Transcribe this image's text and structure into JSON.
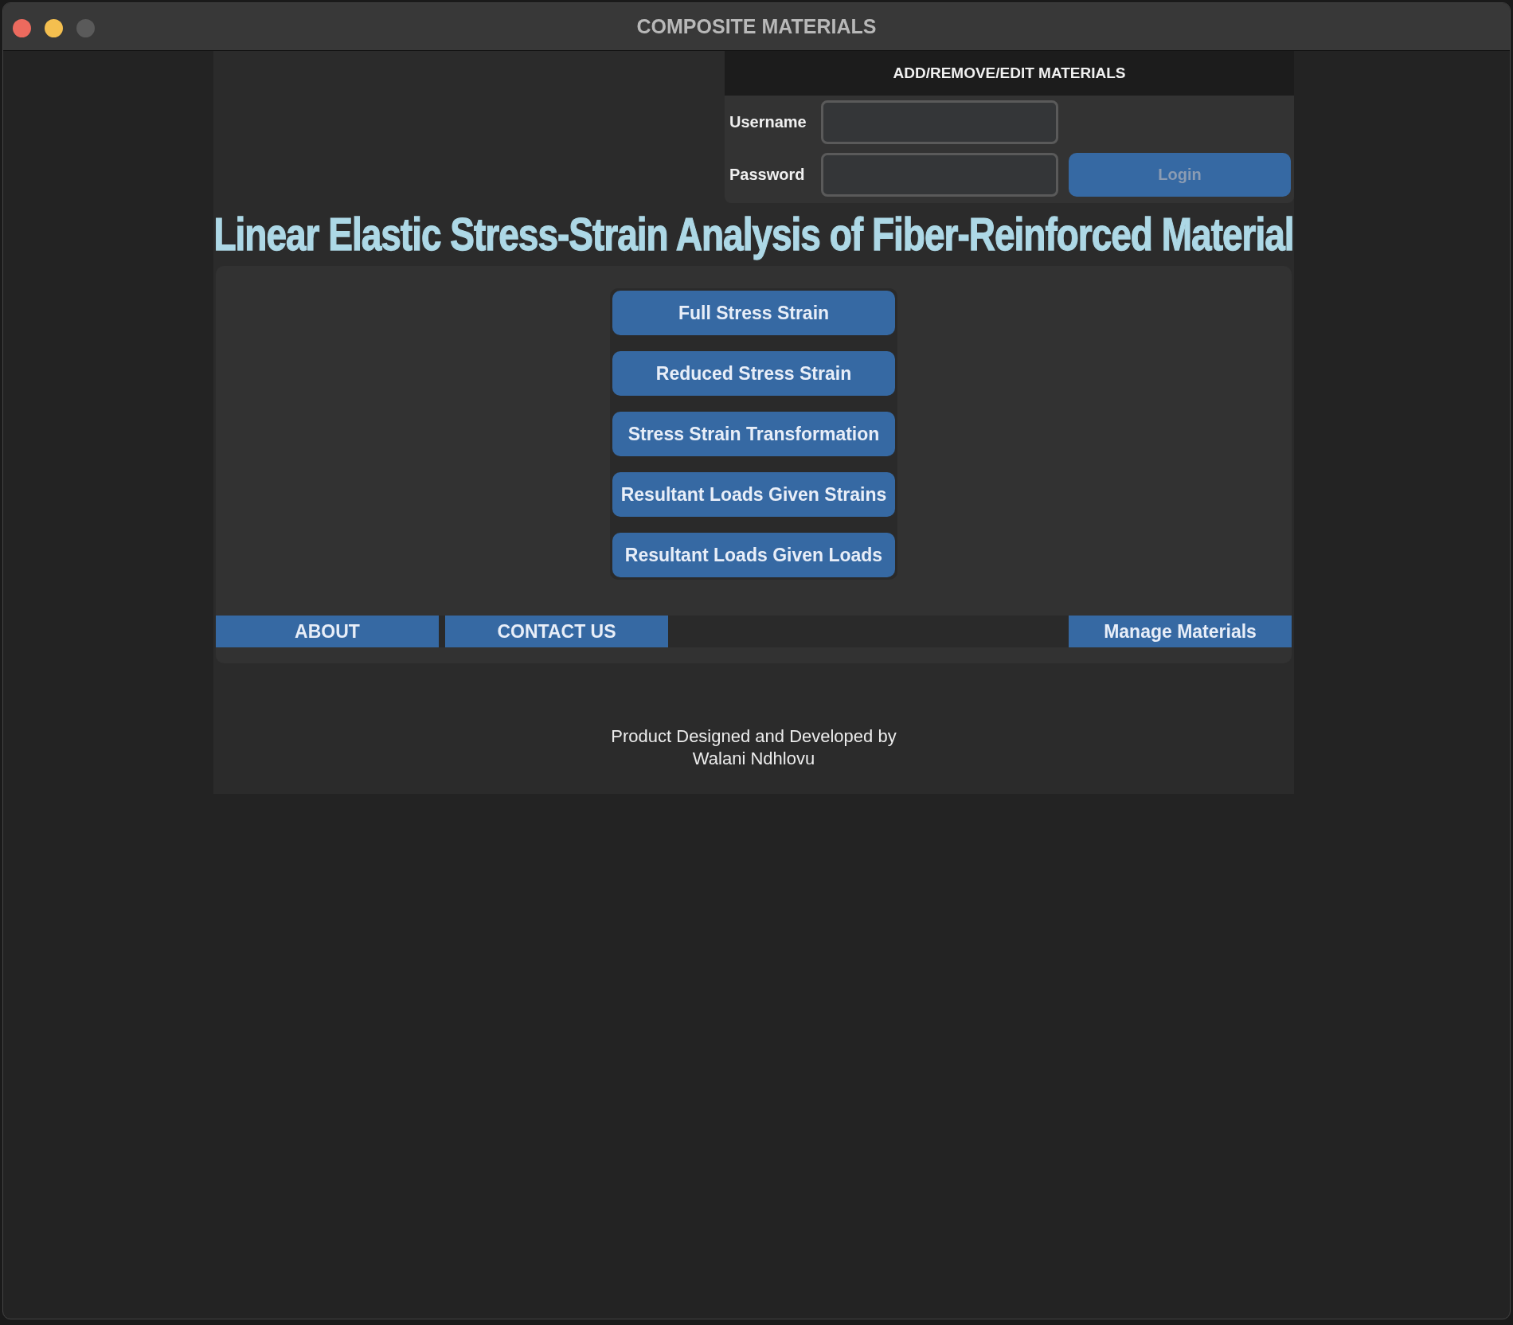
{
  "window": {
    "title": "COMPOSITE MATERIALS"
  },
  "login_panel": {
    "heading": "ADD/REMOVE/EDIT MATERIALS",
    "fields": [
      {
        "label": "Username"
      },
      {
        "label": "Password"
      }
    ],
    "login_button": {
      "label": "Login",
      "disabled": true
    }
  },
  "headline": "Linear Elastic Stress-Strain Analysis of Fiber-Reinforced Material",
  "analysis_buttons": [
    "Full Stress Strain",
    "Reduced Stress Strain",
    "Stress Strain Transformation",
    "Resultant Loads Given Strains",
    "Resultant Loads Given Loads"
  ],
  "nav": {
    "left": [
      "ABOUT",
      "CONTACT US"
    ],
    "right": [
      "Manage Materials"
    ]
  },
  "footer": [
    "Product Designed and Developed by",
    "Walani Ndhlovu"
  ]
}
